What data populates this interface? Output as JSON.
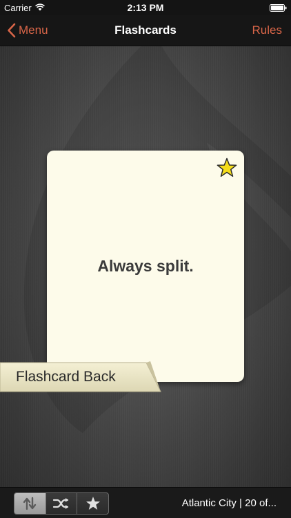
{
  "status": {
    "carrier": "Carrier",
    "time": "2:13 PM"
  },
  "nav": {
    "back_label": "Menu",
    "title": "Flashcards",
    "rules_label": "Rules"
  },
  "card": {
    "text": "Always split.",
    "starred": true
  },
  "ribbon": {
    "label": "Flashcard Back"
  },
  "toolbar": {
    "segments": [
      "flip-icon",
      "shuffle-icon",
      "star-icon"
    ],
    "active_segment": 0,
    "deck_label": "Atlantic City | 20 of..."
  },
  "colors": {
    "accent": "#d86548",
    "card": "#fdfbea",
    "star": "#f5dd1a"
  }
}
